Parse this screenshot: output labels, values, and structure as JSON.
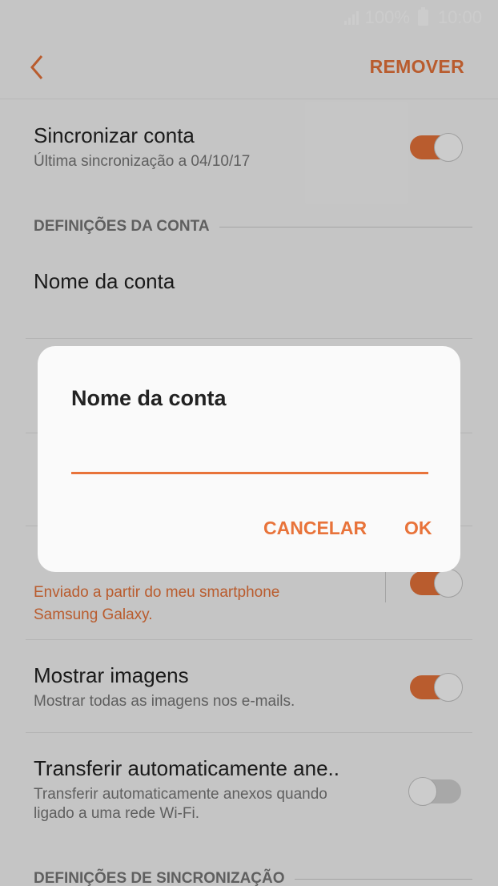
{
  "status_bar": {
    "battery": "100%",
    "time": "10:00"
  },
  "app_bar": {
    "back_icon": "chevron-left-icon",
    "remove_label": "REMOVER"
  },
  "settings": {
    "sync_account": {
      "title": "Sincronizar conta",
      "subtitle": "Última sincronização a 04/10/17",
      "enabled": true
    },
    "account_section_header": "DEFINIÇÕES DA CONTA",
    "account_name": {
      "title": "Nome da conta"
    },
    "signature": {
      "subtitle_line1": "Enviado a partir do meu smartphone",
      "subtitle_line2": "Samsung Galaxy.",
      "enabled": true
    },
    "show_images": {
      "title": "Mostrar imagens",
      "subtitle": "Mostrar todas as imagens nos e-mails.",
      "enabled": true
    },
    "auto_download": {
      "title": "Transferir automaticamente ane..",
      "subtitle_line1": "Transferir automaticamente anexos quando",
      "subtitle_line2": "ligado a uma rede Wi-Fi.",
      "enabled": false
    },
    "sync_section_header": "DEFINIÇÕES DE SINCRONIZAÇÃO"
  },
  "dialog": {
    "title": "Nome da conta",
    "input_value": "",
    "cancel_label": "CANCELAR",
    "ok_label": "OK"
  },
  "colors": {
    "accent": "#e8733a",
    "scrim": "rgba(0,0,0,0.2)"
  }
}
